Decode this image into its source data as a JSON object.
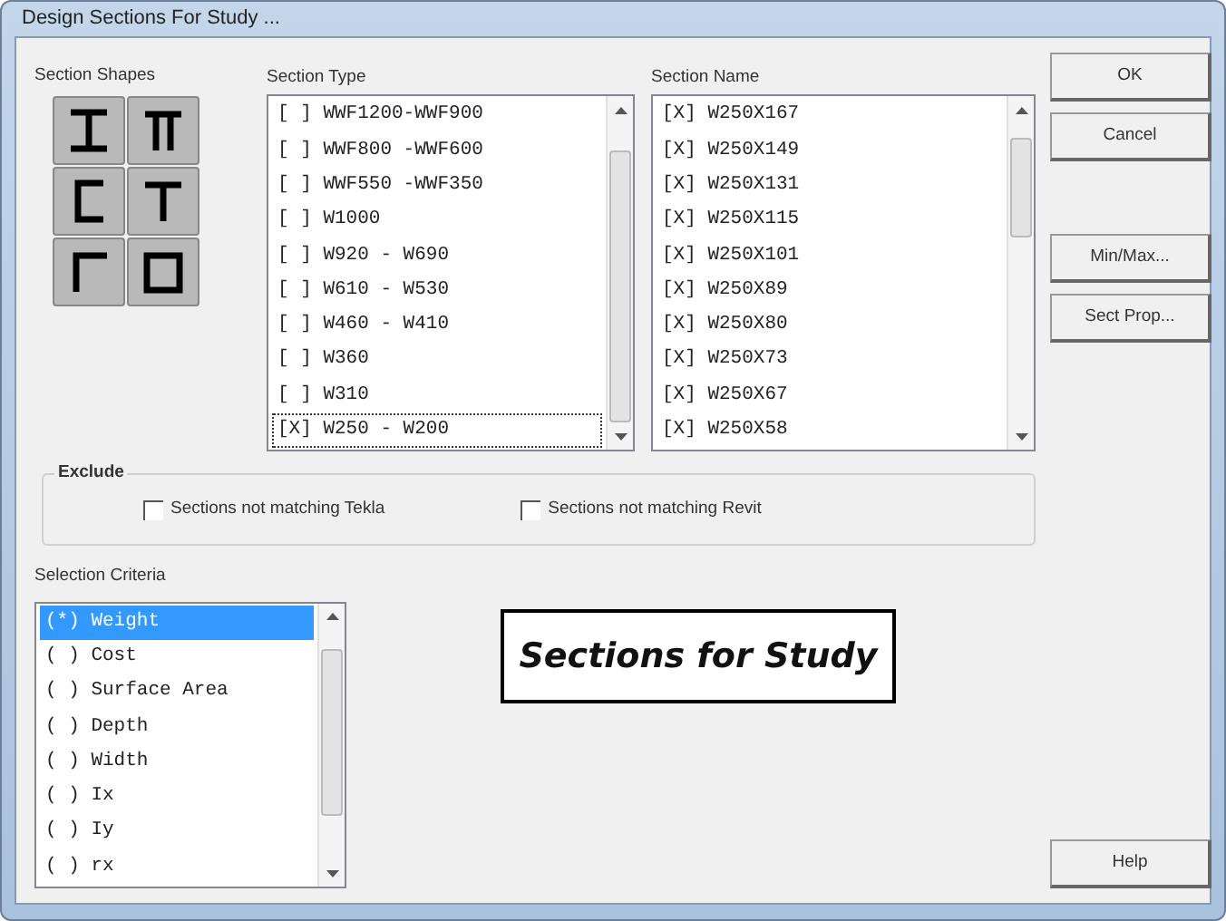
{
  "window": {
    "title": "Design Sections For Study ..."
  },
  "section_shapes": {
    "label": "Section Shapes"
  },
  "section_type": {
    "label": "Section Type",
    "items": [
      {
        "text": "[ ] WWF1200-WWF900",
        "selected": false
      },
      {
        "text": "[ ] WWF800 -WWF600",
        "selected": false
      },
      {
        "text": "[ ] WWF550 -WWF350",
        "selected": false
      },
      {
        "text": "[ ] W1000",
        "selected": false
      },
      {
        "text": "[ ] W920 - W690",
        "selected": false
      },
      {
        "text": "[ ] W610 - W530",
        "selected": false
      },
      {
        "text": "[ ] W460 - W410",
        "selected": false
      },
      {
        "text": "[ ] W360",
        "selected": false
      },
      {
        "text": "[ ] W310",
        "selected": false
      },
      {
        "text": "[X] W250 - W200",
        "selected": true
      }
    ]
  },
  "section_name": {
    "label": "Section Name",
    "items": [
      {
        "text": "[X] W250X167",
        "selected": false
      },
      {
        "text": "[X] W250X149",
        "selected": false
      },
      {
        "text": "[X] W250X131",
        "selected": false
      },
      {
        "text": "[X] W250X115",
        "selected": false
      },
      {
        "text": "[X] W250X101",
        "selected": false
      },
      {
        "text": "[X] W250X89",
        "selected": false
      },
      {
        "text": "[X] W250X80",
        "selected": false
      },
      {
        "text": "[X] W250X73",
        "selected": false
      },
      {
        "text": "[X] W250X67",
        "selected": false
      },
      {
        "text": "[X] W250X58",
        "selected": false
      }
    ]
  },
  "exclude": {
    "label": "Exclude",
    "options": [
      {
        "label": "Sections not matching Tekla",
        "checked": false
      },
      {
        "label": "Sections not matching Revit",
        "checked": false
      }
    ]
  },
  "selection_criteria": {
    "label": "Selection Criteria",
    "items": [
      {
        "text": "(*) Weight",
        "selected": true
      },
      {
        "text": "( ) Cost",
        "selected": false
      },
      {
        "text": "( ) Surface Area",
        "selected": false
      },
      {
        "text": "( ) Depth",
        "selected": false
      },
      {
        "text": "( ) Width",
        "selected": false
      },
      {
        "text": "( ) Ix",
        "selected": false
      },
      {
        "text": "( ) Iy",
        "selected": false
      },
      {
        "text": "( ) rx",
        "selected": false
      }
    ]
  },
  "annotation": "Sections for Study",
  "button_groups": [
    {
      "buttons": [
        "OK",
        "Cancel"
      ]
    },
    {
      "buttons": [
        "Min/Max...",
        "Sect Prop..."
      ]
    },
    {
      "buttons": [
        "Help"
      ]
    }
  ]
}
